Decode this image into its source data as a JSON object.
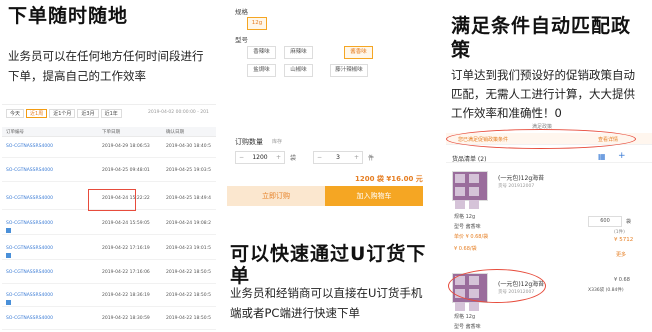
{
  "left": {
    "title": "下单随时随地",
    "desc": "业务员可以在任何地方任何时间段进行下单，提高自己的工作效率",
    "tabs": [
      "今天",
      "近1周",
      "近1个月",
      "近3月",
      "近1年"
    ],
    "active_tab": 1,
    "date_range": "2019-04-02 00:00:00 - 201",
    "columns": [
      "订单编号",
      "下单日期",
      "确认日期"
    ],
    "rows": [
      {
        "id": "SO-CGTNASSRS4000",
        "date": "2019-04-29 18:06:53",
        "confirm": "2019-04-30 18:40:5"
      },
      {
        "id": "SO-CGTNASSRS4000",
        "date": "2019-04-25 09:48:01",
        "confirm": "2019-04-25 19:03:5"
      },
      {
        "id": "SO-CGTNASSRS4000",
        "date": "2019-04-24 15:22:22",
        "confirm": "2019-04-25 18:49:4"
      },
      {
        "id": "SO-CGTNASSRS4000",
        "date": "2019-04-24 15:59:05",
        "confirm": "2019-04-24 19:08:2"
      },
      {
        "id": "SO-CGTNASSRS4000",
        "date": "2019-04-22 17:16:19",
        "confirm": "2019-04-23 19:01:5"
      },
      {
        "id": "SO-CGTNASSRS4000",
        "date": "2019-04-22 17:16:06",
        "confirm": "2019-04-22 18:50:5"
      },
      {
        "id": "SO-CGTNASSRS4000",
        "date": "2019-04-22 18:36:19",
        "confirm": "2019-04-22 18:50:5"
      },
      {
        "id": "SO-CGTNASSRS4000",
        "date": "2019-04-22 18:30:59",
        "confirm": "2019-04-22 18:50:5"
      }
    ]
  },
  "middle": {
    "spec_label": "规格",
    "spec_value": "12g",
    "model_label": "型号",
    "models": [
      "香辣味",
      "麻辣味",
      "酱香味",
      "盐焗味",
      "山椒味",
      "藤汁辣椒味"
    ],
    "selected_model": 2,
    "qty_label": "订购数量",
    "stock_label": "库存",
    "qty_value": "1200",
    "unit_a": "袋",
    "qty_value2": "3",
    "unit_b": "件",
    "total": "1200 袋   ¥16.00 元",
    "order_button": "立即订购",
    "cart_button": "加入购物车",
    "title": "可以快速通过U订货下单",
    "desc": "业务员和经销商可以直接在U订货手机端或者PC端进行快速下单"
  },
  "right": {
    "title": "满足条件自动匹配政策",
    "desc": "订单达到我们预设好的促销政策自动匹配，无需人工进行计算，大大提供工作效率和准确性！0",
    "header_note": "满足政策",
    "promo_bar": "您已满足促销政策条件",
    "promo_link": "查看详情",
    "list_label": "货品清单 (2)",
    "items": [
      {
        "name": "(一元包)12g海苔",
        "code": "货号 201912007",
        "spec": "规格 12g",
        "model": "型号 酱香味",
        "price1": "单价 ¥ 0.68/袋",
        "price2": "¥ 0.68/袋",
        "qty": "600",
        "unit": "袋",
        "sub": "(1件)",
        "amount": "¥ 5712",
        "more": "更多"
      },
      {
        "name": "(一元包)12g海苔",
        "code": "货号 201912007",
        "spec": "规格 12g",
        "model": "型号 酱香味",
        "price": "¥ 0.68",
        "detail": "X336袋 (0.84件)"
      }
    ]
  }
}
